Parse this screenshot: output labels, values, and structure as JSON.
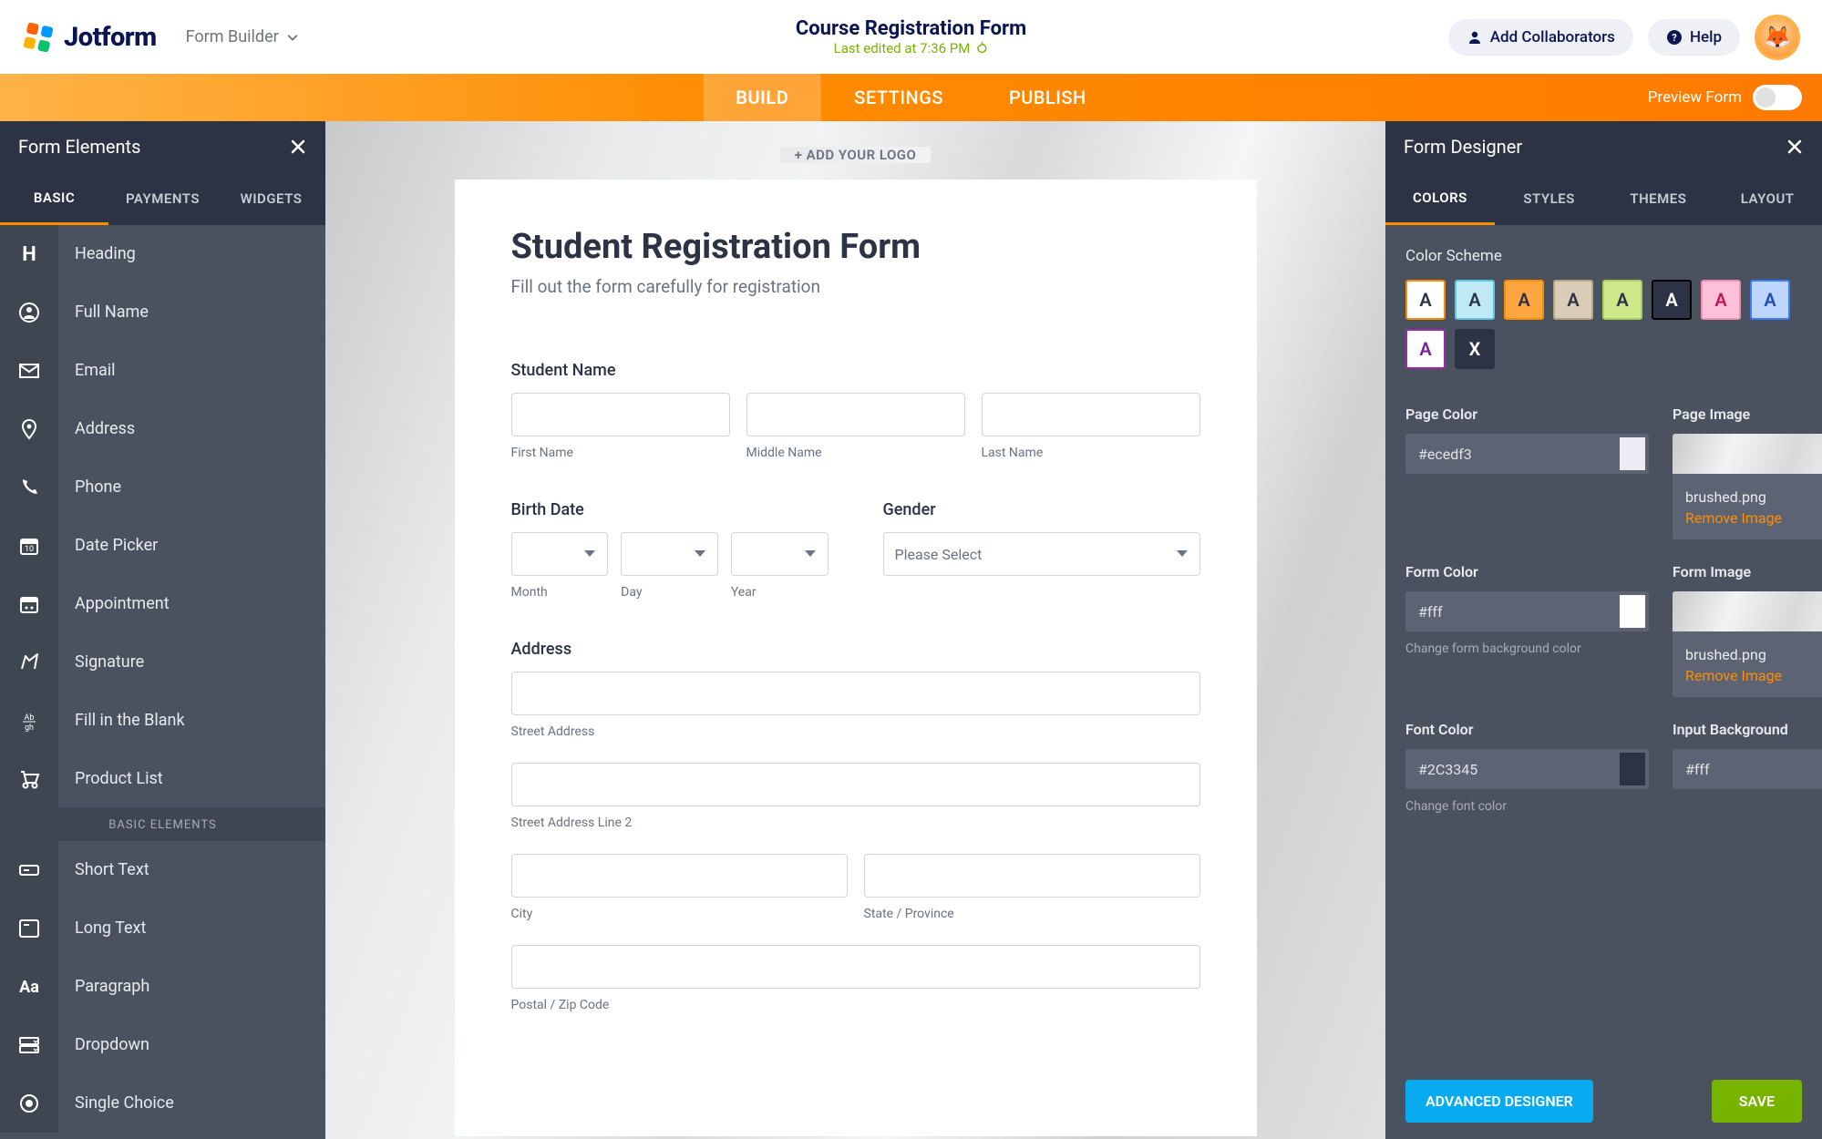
{
  "header": {
    "logo_text": "Jotform",
    "builder_label": "Form Builder",
    "title": "Course Registration Form",
    "subtitle": "Last edited at 7:36 PM",
    "add_collab": "Add Collaborators",
    "help": "Help"
  },
  "tabs": {
    "build": "BUILD",
    "settings": "SETTINGS",
    "publish": "PUBLISH",
    "preview": "Preview Form"
  },
  "left": {
    "title": "Form Elements",
    "tabs": {
      "basic": "BASIC",
      "payments": "PAYMENTS",
      "widgets": "WIDGETS"
    },
    "items": [
      {
        "label": "Heading"
      },
      {
        "label": "Full Name"
      },
      {
        "label": "Email"
      },
      {
        "label": "Address"
      },
      {
        "label": "Phone"
      },
      {
        "label": "Date Picker"
      },
      {
        "label": "Appointment"
      },
      {
        "label": "Signature"
      },
      {
        "label": "Fill in the Blank"
      },
      {
        "label": "Product List"
      }
    ],
    "section": "BASIC ELEMENTS",
    "items2": [
      {
        "label": "Short Text"
      },
      {
        "label": "Long Text"
      },
      {
        "label": "Paragraph"
      },
      {
        "label": "Dropdown"
      },
      {
        "label": "Single Choice"
      }
    ]
  },
  "form": {
    "add_logo": "+ ADD YOUR LOGO",
    "title": "Student Registration Form",
    "subtitle": "Fill out the form carefully for registration",
    "student_name": "Student Name",
    "first_name": "First Name",
    "middle_name": "Middle Name",
    "last_name": "Last Name",
    "birth_date": "Birth Date",
    "month": "Month",
    "day": "Day",
    "year": "Year",
    "gender": "Gender",
    "gender_placeholder": "Please Select",
    "address": "Address",
    "street": "Street Address",
    "street2": "Street Address Line 2",
    "city": "City",
    "state": "State / Province",
    "postal": "Postal / Zip Code"
  },
  "right": {
    "title": "Form Designer",
    "tabs": {
      "colors": "COLORS",
      "styles": "STYLES",
      "themes": "THEMES",
      "layout": "LAYOUT"
    },
    "scheme_label": "Color Scheme",
    "swatches": [
      {
        "bg": "#ffffff",
        "fg": "#2c3345",
        "border": "#ff8c00",
        "t": "A"
      },
      {
        "bg": "#bfe9f5",
        "fg": "#2c3345",
        "border": "#5ac8e8",
        "t": "A"
      },
      {
        "bg": "#ffa640",
        "fg": "#2c3345",
        "border": "#ff8c00",
        "t": "A"
      },
      {
        "bg": "#d9cdb8",
        "fg": "#2c3345",
        "border": "#b5a67f",
        "t": "A"
      },
      {
        "bg": "#cce88a",
        "fg": "#2c3345",
        "border": "#a8d15a",
        "t": "A"
      },
      {
        "bg": "#2c3345",
        "fg": "#ffffff",
        "border": "#000000",
        "t": "A"
      },
      {
        "bg": "#ffc0d9",
        "fg": "#c2185b",
        "border": "#f48fb1",
        "t": "A"
      },
      {
        "bg": "#bcd6ff",
        "fg": "#1e4db7",
        "border": "#3a7bff",
        "t": "A"
      },
      {
        "bg": "#ffffff",
        "fg": "#7b1fa2",
        "border": "#9c27b0",
        "t": "A"
      },
      {
        "bg": "#2c3345",
        "fg": "#ffffff",
        "border": "#2c3345",
        "t": "X"
      }
    ],
    "page_color_label": "Page Color",
    "page_color": "#ecedf3",
    "page_image_label": "Page Image",
    "page_image_name": "brushed.png",
    "remove_image": "Remove Image",
    "form_color_label": "Form Color",
    "form_color": "#fff",
    "form_color_hint": "Change form background color",
    "form_image_label": "Form Image",
    "form_image_name": "brushed.png",
    "font_color_label": "Font Color",
    "font_color": "#2C3345",
    "font_color_hint": "Change font color",
    "input_bg_label": "Input Background",
    "input_bg": "#fff",
    "advanced": "ADVANCED DESIGNER",
    "save": "SAVE"
  }
}
